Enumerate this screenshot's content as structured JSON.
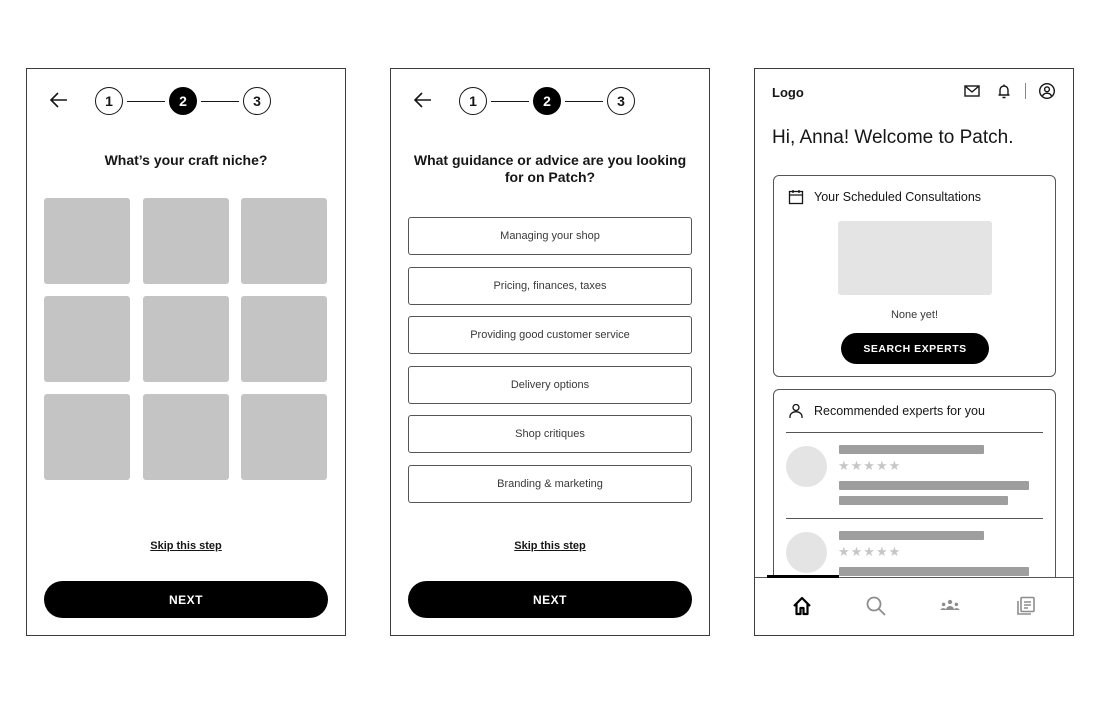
{
  "screens": {
    "craft_niche": {
      "stepper": {
        "steps": [
          "1",
          "2",
          "3"
        ],
        "active_step": 2
      },
      "question": "What’s your craft niche?",
      "tile_count": 9,
      "skip_label": "Skip this step",
      "next_label": "NEXT"
    },
    "guidance": {
      "stepper": {
        "steps": [
          "1",
          "2",
          "3"
        ],
        "active_step": 2
      },
      "question": "What guidance or advice are you looking for on Patch?",
      "options": [
        "Managing your shop",
        "Pricing, finances, taxes",
        "Providing good customer service",
        "Delivery options",
        "Shop critiques",
        "Branding & marketing"
      ],
      "skip_label": "Skip this step",
      "next_label": "NEXT"
    },
    "dashboard": {
      "logo": "Logo",
      "header_icons": [
        "mail-icon",
        "bell-icon",
        "profile-icon"
      ],
      "greeting": "Hi, Anna! Welcome to Patch.",
      "consultations": {
        "title": "Your Scheduled Consultations",
        "icon": "calendar-icon",
        "empty_text": "None yet!",
        "button_label": "SEARCH EXPERTS"
      },
      "recommended": {
        "title": "Recommended experts for you",
        "icon": "person-icon",
        "experts": [
          {
            "rating_stars": 5
          },
          {
            "rating_stars": 5
          }
        ]
      },
      "tabbar": {
        "tabs": [
          {
            "name": "home",
            "icon": "home-icon",
            "active": true
          },
          {
            "name": "search",
            "icon": "search-icon",
            "active": false
          },
          {
            "name": "community",
            "icon": "community-icon",
            "active": false
          },
          {
            "name": "library",
            "icon": "library-icon",
            "active": false
          }
        ]
      }
    }
  },
  "colors": {
    "primary": "#000000",
    "placeholder": "#c4c4c4",
    "light_placeholder": "#e4e4e4",
    "inactive_icon": "#8d8d8d"
  }
}
